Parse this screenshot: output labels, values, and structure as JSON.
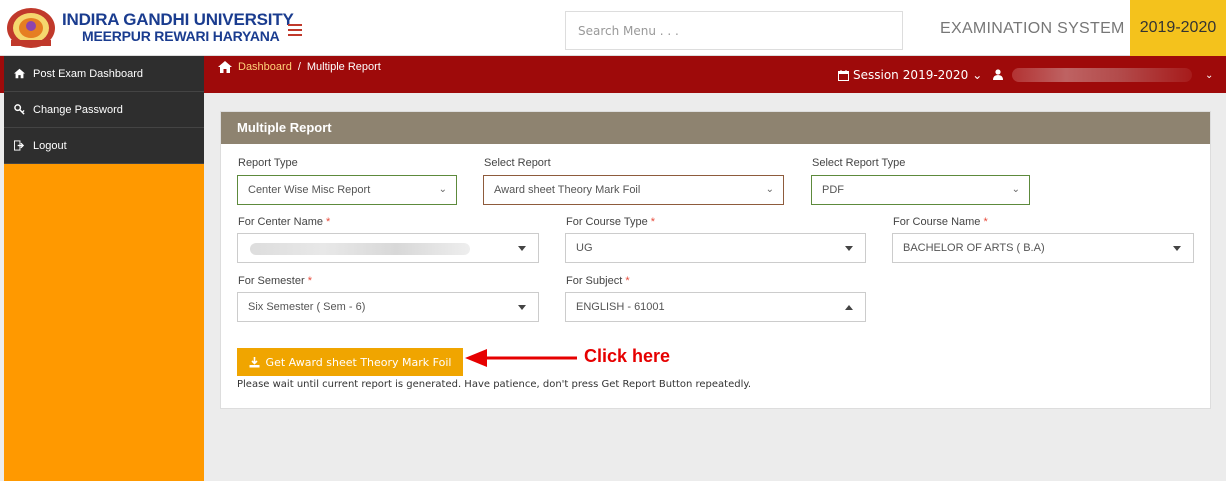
{
  "header": {
    "university_line1": "INDIRA GANDHI UNIVERSITY",
    "university_line2": "MEERPUR REWARI HARYANA",
    "search_placeholder": "Search Menu . . .",
    "system_title": "EXAMINATION SYSTEM",
    "year": "2019-2020"
  },
  "topbar": {
    "breadcrumb_link": "Dashboard",
    "breadcrumb_sep": "/",
    "breadcrumb_current": "Multiple Report",
    "session_label": "Session",
    "session_value": "2019-2020"
  },
  "sidebar": {
    "items": [
      {
        "label": "Post Exam Dashboard",
        "icon": "home-icon"
      },
      {
        "label": "Change Password",
        "icon": "key-icon"
      },
      {
        "label": "Logout",
        "icon": "logout-icon"
      }
    ]
  },
  "panel": {
    "title": "Multiple Report",
    "report_type": {
      "label": "Report Type",
      "value": "Center Wise Misc Report"
    },
    "select_report": {
      "label": "Select Report",
      "value": "Award sheet Theory Mark Foil"
    },
    "select_report_type": {
      "label": "Select Report Type",
      "value": "PDF"
    },
    "center_name": {
      "label": "For Center Name",
      "value": ""
    },
    "course_type": {
      "label": "For Course Type",
      "value": "UG"
    },
    "course_name": {
      "label": "For Course Name",
      "value": "BACHELOR OF ARTS ( B.A)"
    },
    "semester": {
      "label": "For Semester",
      "value": "Six Semester ( Sem - 6)"
    },
    "subject": {
      "label": "For Subject",
      "value": "ENGLISH - 61001"
    },
    "required_mark": "*",
    "button_label": "Get Award sheet Theory Mark Foil",
    "note": "Please wait until current report is generated. Have patience, don't press Get Report Button repeatedly."
  },
  "annotation": {
    "text": "Click here",
    "color": "#e60000"
  },
  "colors": {
    "topbar": "#9e0a0a",
    "sidebar": "#ff9900",
    "year_badge": "#f4c21c",
    "panel_head": "#8e8370",
    "button": "#f0a500"
  }
}
